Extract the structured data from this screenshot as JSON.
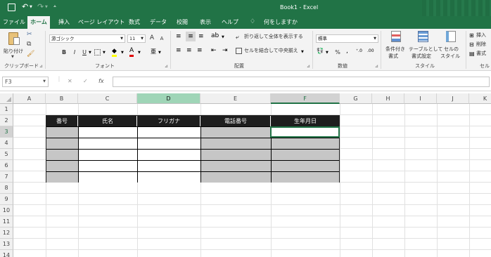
{
  "title": {
    "doc": "Book1",
    "sep": "-",
    "app": "Excel"
  },
  "tabs": [
    "ファイル",
    "ホーム",
    "挿入",
    "ページ レイアウト",
    "数式",
    "データ",
    "校閲",
    "表示",
    "ヘルプ",
    "何をしますか"
  ],
  "active_tab": "ホーム",
  "ribbon": {
    "paste": "貼り付け",
    "clipboard": "クリップボード",
    "font_name": "游ゴシック",
    "font_size": "11",
    "font_group": "フォント",
    "bold": "B",
    "italic": "I",
    "underline": "U",
    "grow": "A",
    "shrink": "A",
    "wrap": "折り返して全体を表示する",
    "merge": "セルを結合して中央揃え",
    "align_group": "配置",
    "num_format": "標準",
    "num_group": "数値",
    "percent": "%",
    "cond_format_1": "条件付き",
    "cond_format_2": "書式",
    "table_fmt_1": "テーブルとして",
    "table_fmt_2": "書式設定",
    "cell_style_1": "セルの",
    "cell_style_2": "スタイル",
    "style_group": "スタイル",
    "insert": "挿入",
    "delete": "削除",
    "format": "書式",
    "cells_group": "セル"
  },
  "formula_bar": {
    "name_box": "F3",
    "fx": "fx",
    "value": ""
  },
  "columns": [
    "A",
    "B",
    "C",
    "D",
    "E",
    "F",
    "G",
    "H",
    "I",
    "J",
    "K"
  ],
  "rows": [
    "1",
    "2",
    "3",
    "4",
    "5",
    "6",
    "7",
    "8",
    "9",
    "10",
    "11",
    "12",
    "13",
    "14"
  ],
  "table": {
    "headers": [
      "番号",
      "氏名",
      "フリガナ",
      "電話番号",
      "生年月日"
    ],
    "data_rows": 5
  },
  "colors": {
    "excel_green": "#217346",
    "header_dark": "#1e1e1e",
    "shade": "#c6c6c6",
    "selection": "#217346"
  }
}
